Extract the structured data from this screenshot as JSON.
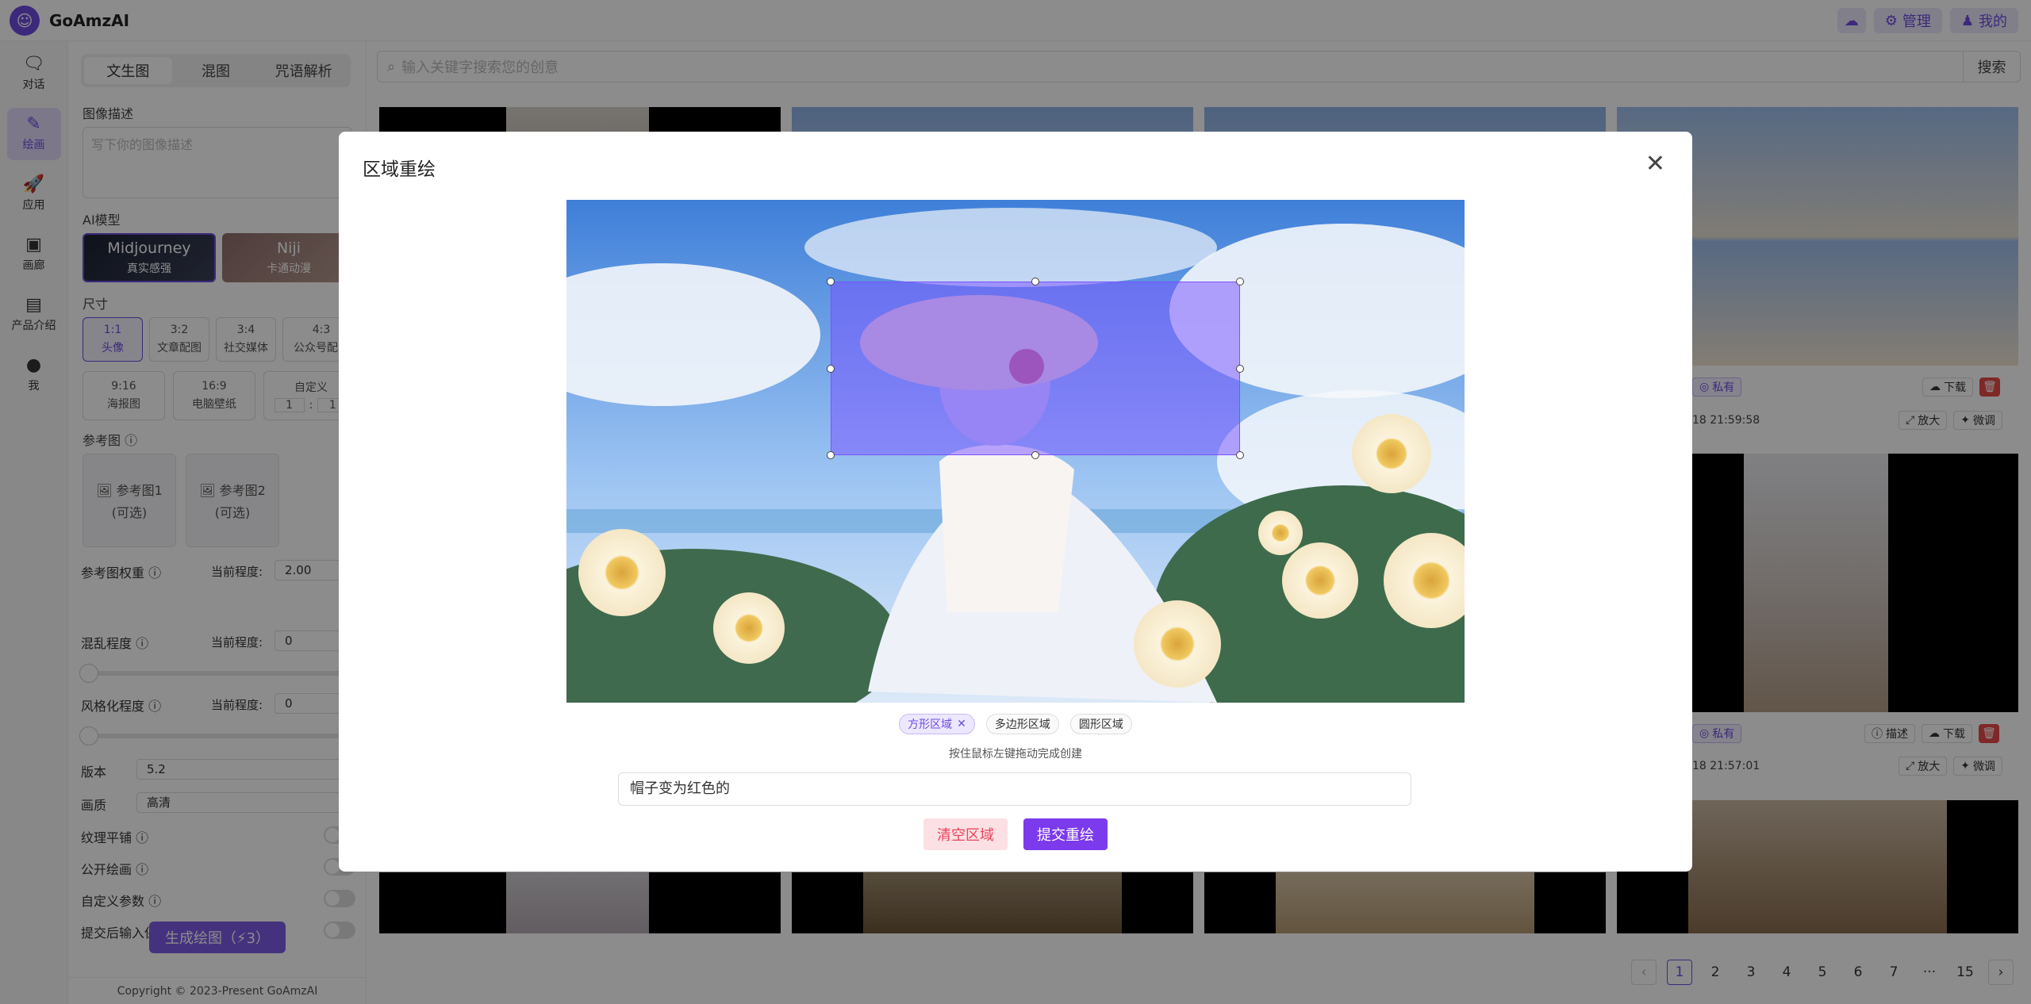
{
  "app": {
    "name": "GoAmzAI"
  },
  "topbar": {
    "admin_label": "管理",
    "me_label": "我的"
  },
  "nav": [
    {
      "label": "对话",
      "icon": "chat-icon"
    },
    {
      "label": "绘画",
      "icon": "brush-icon"
    },
    {
      "label": "应用",
      "icon": "rocket-icon"
    },
    {
      "label": "画廊",
      "icon": "gallery-icon"
    },
    {
      "label": "产品介绍",
      "icon": "book-icon"
    },
    {
      "label": "我",
      "icon": "user-icon"
    }
  ],
  "panel": {
    "tabs": [
      "文生图",
      "混图",
      "咒语解析"
    ],
    "desc_label": "图像描述",
    "desc_placeholder": "写下你的图像描述",
    "model_label": "AI模型",
    "models": [
      {
        "name": "Midjourney",
        "sub": "真实感强"
      },
      {
        "name": "Niji",
        "sub": "卡通动漫"
      }
    ],
    "size_label": "尺寸",
    "sizes_row1": [
      {
        "ratio": "1:1",
        "name": "头像"
      },
      {
        "ratio": "3:2",
        "name": "文章配图"
      },
      {
        "ratio": "3:4",
        "name": "社交媒体"
      },
      {
        "ratio": "4:3",
        "name": "公众号配图"
      }
    ],
    "sizes_row2": [
      {
        "ratio": "9:16",
        "name": "海报图"
      },
      {
        "ratio": "16:9",
        "name": "电脑壁纸"
      },
      {
        "ratio": "自定义",
        "name": ""
      }
    ],
    "custom_w": "1",
    "custom_sep": ":",
    "custom_h": "1",
    "ref_label": "参考图",
    "refs": [
      {
        "name": "参考图1",
        "opt": "(可选)"
      },
      {
        "name": "参考图2",
        "opt": "(可选)"
      }
    ],
    "weight_label": "参考图权重",
    "current_label": "当前程度:",
    "weight_value": "2.00",
    "chaos_label": "混乱程度",
    "chaos_value": "0",
    "stylize_label": "风格化程度",
    "stylize_value": "0",
    "version_label": "版本",
    "version_value": "5.2",
    "quality_label": "画质",
    "quality_value": "高清",
    "tile_label": "纹理平铺",
    "public_label": "公开绘画",
    "custom_params_label": "自定义参数",
    "keep_input_label": "提交后输入保留",
    "generate_label": "生成绘图（⚡3）",
    "copyright": "Copyright © 2023-Present GoAmzAI"
  },
  "search": {
    "placeholder": "输入关键字搜索您的创意",
    "button": "搜索"
  },
  "gallery": {
    "private_label": "私有",
    "download_label": "下载",
    "upscale_label": "放大",
    "vary_label": "微调",
    "describe_label": "描述",
    "time1": "18 21:59:58",
    "time2": "18 21:57:01"
  },
  "pagination": {
    "pages": [
      "1",
      "2",
      "3",
      "4",
      "5",
      "6",
      "7",
      "···",
      "15"
    ],
    "current": "1"
  },
  "modal": {
    "title": "区域重绘",
    "modes": [
      "方形区域",
      "多边形区域",
      "圆形区域"
    ],
    "active_mode": "方形区域",
    "hint": "按住鼠标左键拖动完成创建",
    "prompt_value": "帽子变为红色的",
    "clear_label": "清空区域",
    "submit_label": "提交重绘"
  },
  "colors": {
    "accent": "#6d4ce0",
    "submit": "#7c3aed",
    "danger": "#e84a4a"
  }
}
